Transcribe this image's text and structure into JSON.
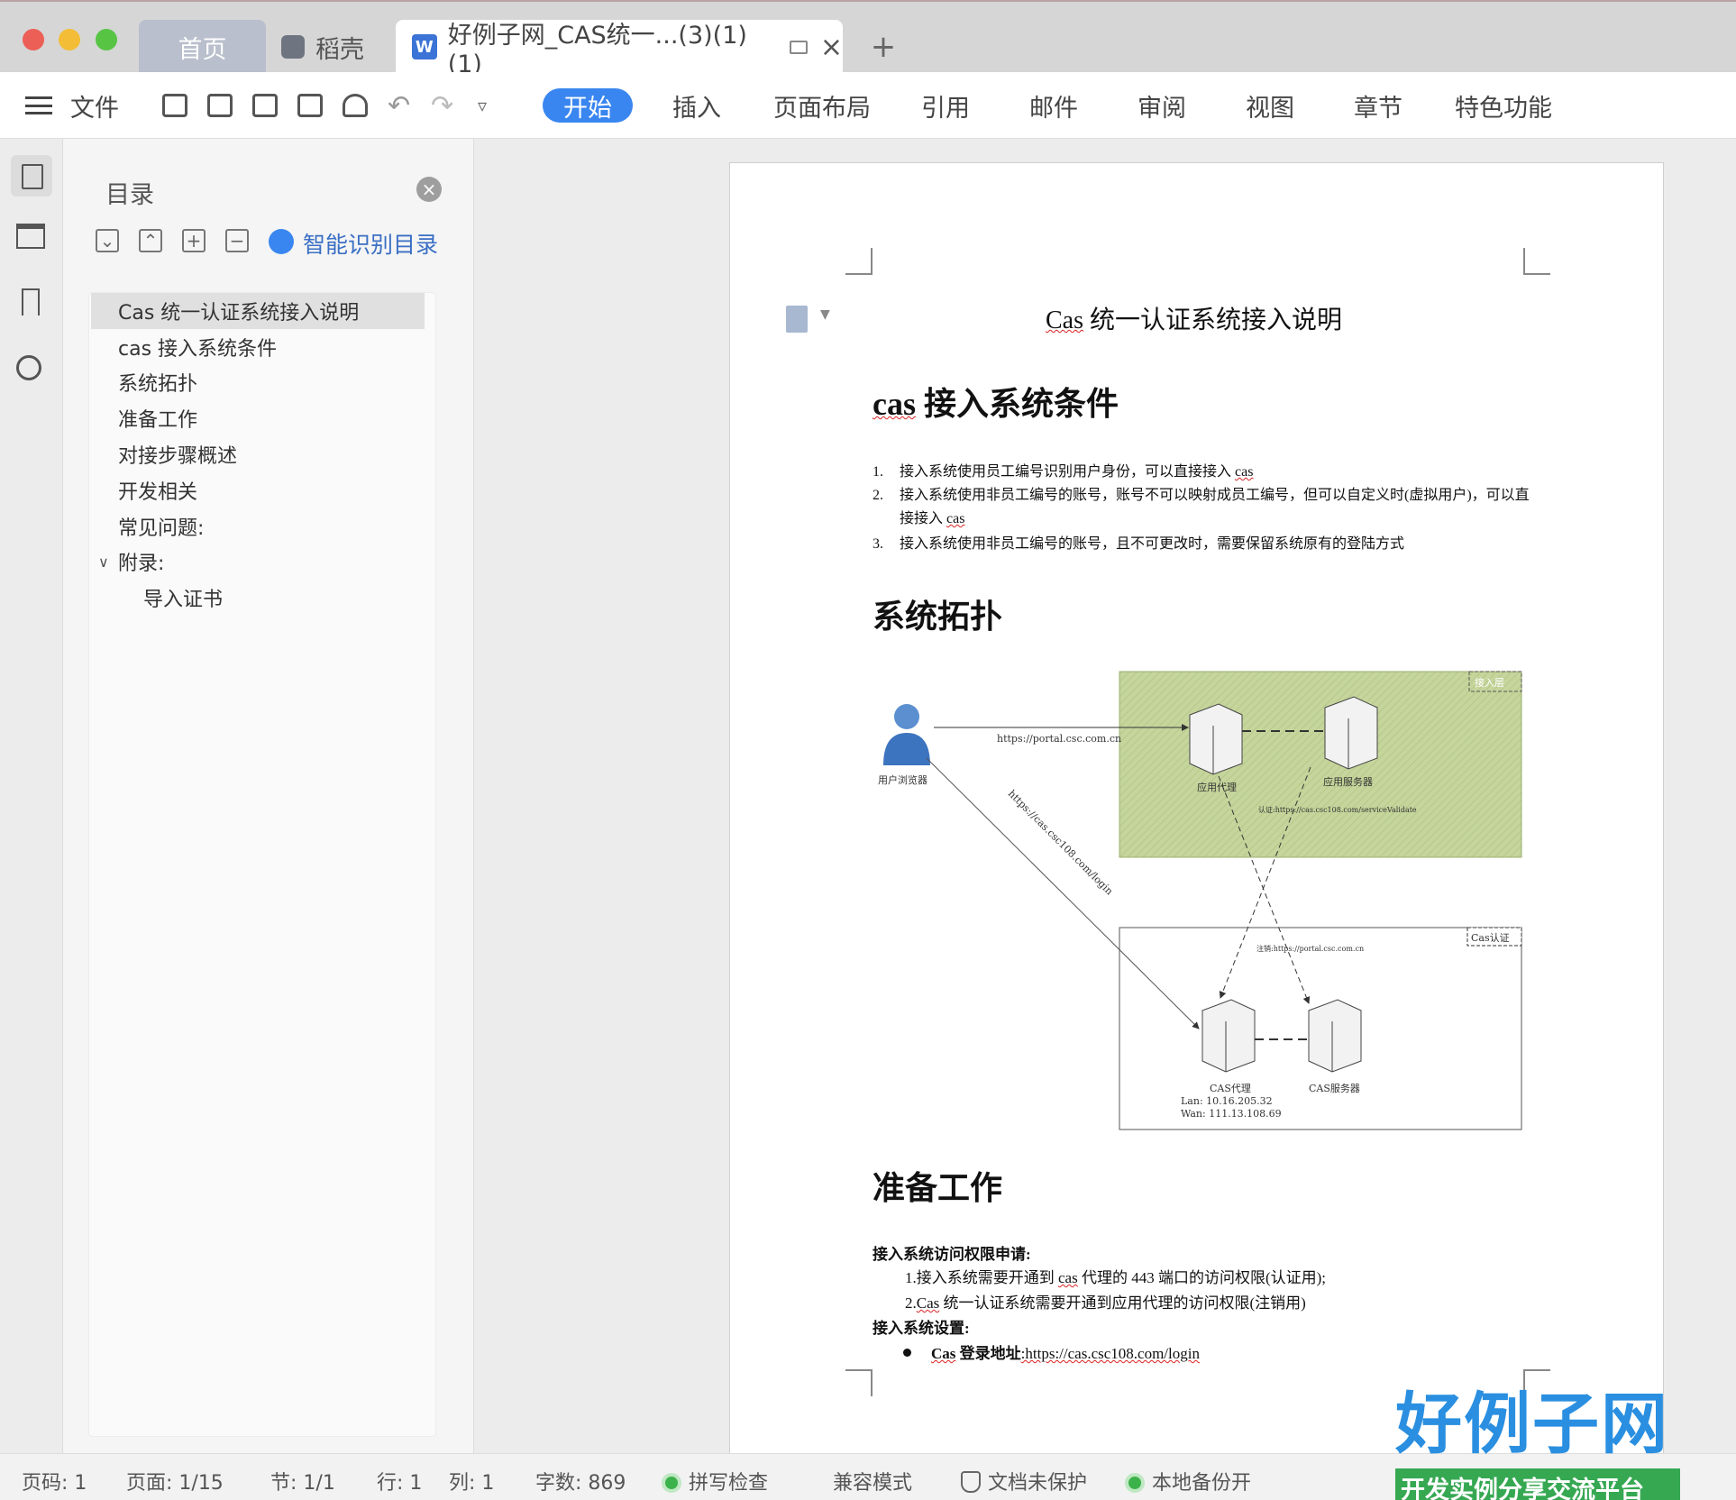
{
  "tabs": {
    "home": "首页",
    "docer": "稻壳",
    "document": "好例子网_CAS统一...(3)(1) (1)"
  },
  "ribbon": {
    "file": "文件",
    "tabs": [
      "开始",
      "插入",
      "页面布局",
      "引用",
      "邮件",
      "审阅",
      "视图",
      "章节",
      "特色功能"
    ]
  },
  "toc": {
    "title": "目录",
    "smart": "智能识别目录",
    "items": [
      {
        "label": "Cas 统一认证系统接入说明"
      },
      {
        "label": "cas 接入系统条件"
      },
      {
        "label": "系统拓扑"
      },
      {
        "label": "准备工作"
      },
      {
        "label": "对接步骤概述"
      },
      {
        "label": "开发相关"
      },
      {
        "label": "常见问题:"
      },
      {
        "label": "附录:"
      },
      {
        "label": "导入证书"
      }
    ]
  },
  "document": {
    "title_prefix": "Cas",
    "title_rest": " 统一认证系统接入说明",
    "h_cond_prefix": "cas",
    "h_cond_rest": " 接入系统条件",
    "conditions": [
      {
        "num": "1.",
        "text": "接入系统使用员工编号识别用户身份，可以直接接入 ",
        "tail": "cas"
      },
      {
        "num": "2.",
        "text": "接入系统使用非员工编号的账号，账号不可以映射成员工编号，但可以自定义时(虚拟用户)，可以直接接入 ",
        "tail": "cas"
      },
      {
        "num": "3.",
        "text": "接入系统使用非员工编号的账号，且不可更改时，需要保留系统原有的登陆方式",
        "tail": ""
      }
    ],
    "h_topo": "系统拓扑",
    "diagram": {
      "access_layer": "接入层",
      "browser": "用户浏览器",
      "portal_url": "https://portal.csc.com.cn",
      "app_proxy": "应用代理",
      "app_server": "应用服务器",
      "validate": "认证:https://cas.csc108.com/serviceValidate",
      "cas_login": "https://cas.csc108.com/login",
      "cas_group": "Cas认证",
      "logout": "注销:https://portal.csc.com.cn",
      "cas_proxy": "CAS代理",
      "cas_server": "CAS服务器",
      "lan": "Lan: 10.16.205.32",
      "wan": "Wan: 111.13.108.69"
    },
    "h_prep": "准备工作",
    "prep": {
      "access_title": "接入系统访问权限申请:",
      "access_1_a": "1.接入系统需要开通到 ",
      "access_1_b": "cas",
      "access_1_c": " 代理的 443 端口的访问权限(认证用);",
      "access_2_a": "2.",
      "access_2_b": "Cas",
      "access_2_c": " 统一认证系统需要开通到应用代理的访问权限(注销用)",
      "settings_title": "接入系统设置:",
      "login_label_a": "Cas",
      "login_label_b": " 登录地址",
      "login_url": ":https://cas.csc108.com/login"
    }
  },
  "status": {
    "page": "页码: 1",
    "pages": "页面: 1/15",
    "section": "节: 1/1",
    "row": "行: 1",
    "col": "列: 1",
    "words": "字数: 869",
    "spell": "拼写检查",
    "compat": "兼容模式",
    "protect": "文档未保护",
    "backup": "本地备份开"
  },
  "watermark": {
    "big": "好例子网",
    "small": "开发实例分享交流平台"
  }
}
